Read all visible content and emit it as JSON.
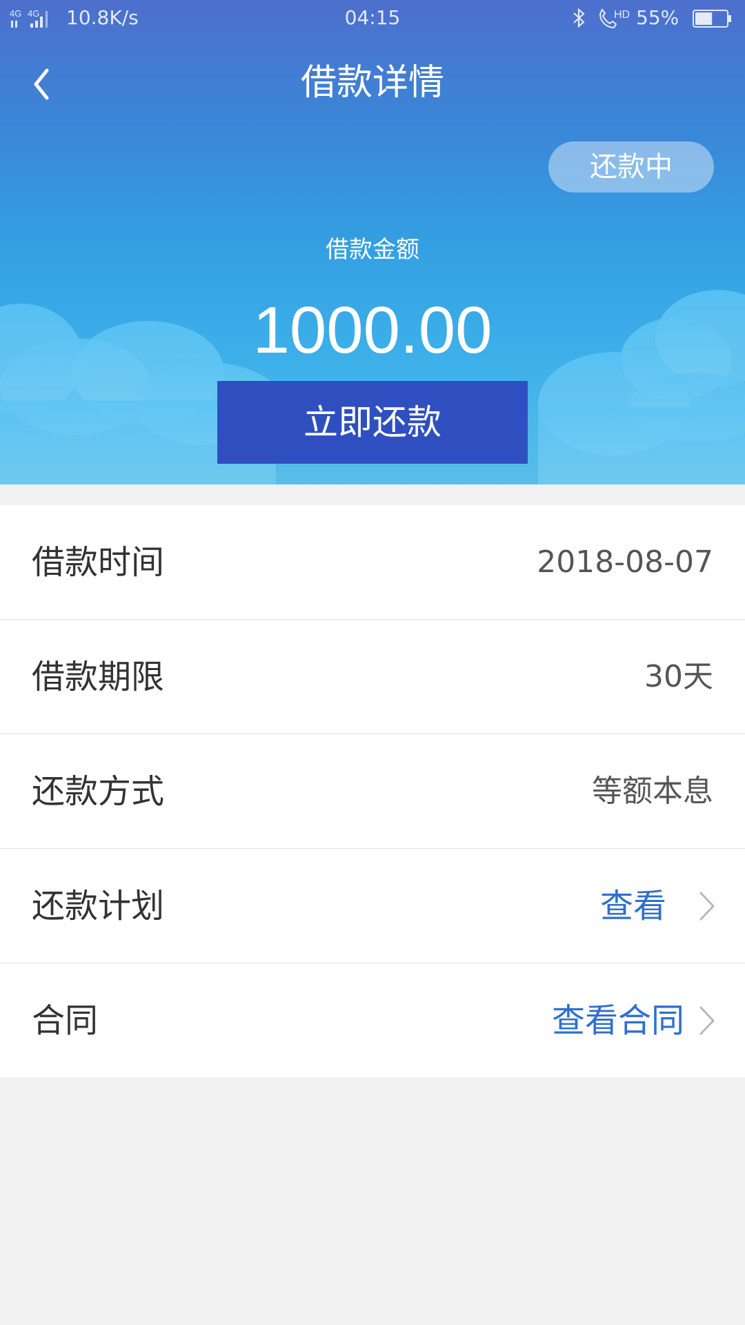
{
  "status_bar": {
    "network": "4G 4G",
    "speed": "10.8K/s",
    "time": "04:15",
    "battery": "55%",
    "battery_level": 0.55
  },
  "nav": {
    "title": "借款详情",
    "back_icon": "chevron-left-icon"
  },
  "header": {
    "status_badge": "还款中",
    "amount_label": "借款金额",
    "amount_value": "1000.00",
    "repay_button": "立即还款"
  },
  "details": [
    {
      "label": "借款时间",
      "value": "2018-08-07"
    },
    {
      "label": "借款期限",
      "value": "30天"
    },
    {
      "label": "还款方式",
      "value": "等额本息"
    },
    {
      "label": "还款计划",
      "link": "查看"
    },
    {
      "label": "合同",
      "link": "查看合同"
    }
  ],
  "colors": {
    "header_top": "#4d6fcc",
    "header_bottom": "#58bde8",
    "button": "#2f4fc0",
    "link": "#2f6fcf",
    "background": "#f1f1f1"
  }
}
